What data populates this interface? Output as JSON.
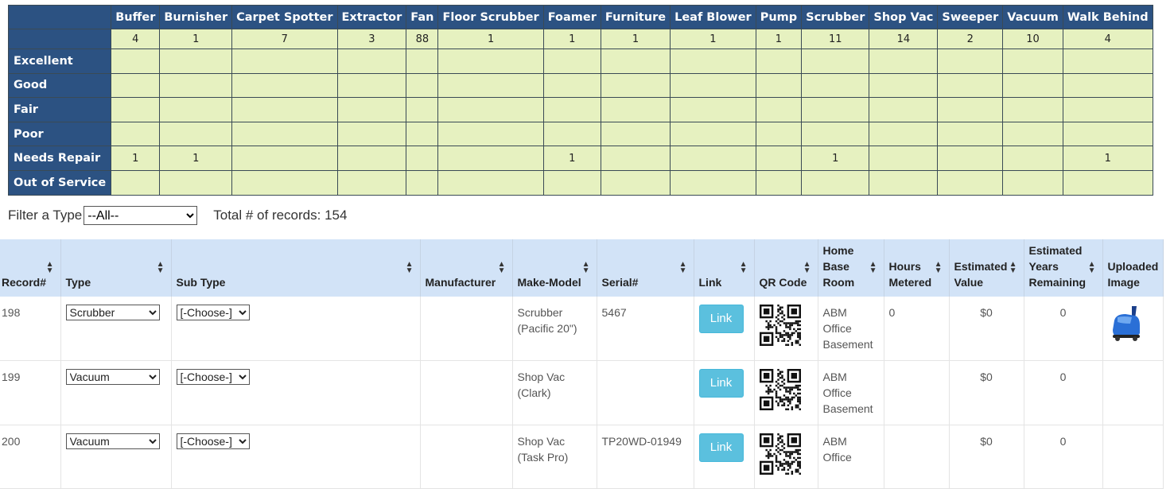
{
  "summary": {
    "columns": [
      "Buffer",
      "Burnisher",
      "Carpet Spotter",
      "Extractor",
      "Fan",
      "Floor Scrubber",
      "Foamer",
      "Furniture",
      "Leaf Blower",
      "Pump",
      "Scrubber",
      "Shop Vac",
      "Sweeper",
      "Vacuum",
      "Walk Behind"
    ],
    "counts": [
      "4",
      "1",
      "7",
      "3",
      "88",
      "1",
      "1",
      "1",
      "1",
      "1",
      "11",
      "14",
      "2",
      "10",
      "4"
    ],
    "rows": [
      {
        "label": "Excellent",
        "values": [
          "",
          "",
          "",
          "",
          "",
          "",
          "",
          "",
          "",
          "",
          "",
          "",
          "",
          "",
          ""
        ]
      },
      {
        "label": "Good",
        "values": [
          "",
          "",
          "",
          "",
          "",
          "",
          "",
          "",
          "",
          "",
          "",
          "",
          "",
          "",
          ""
        ]
      },
      {
        "label": "Fair",
        "values": [
          "",
          "",
          "",
          "",
          "",
          "",
          "",
          "",
          "",
          "",
          "",
          "",
          "",
          "",
          ""
        ]
      },
      {
        "label": "Poor",
        "values": [
          "",
          "",
          "",
          "",
          "",
          "",
          "",
          "",
          "",
          "",
          "",
          "",
          "",
          "",
          ""
        ]
      },
      {
        "label": "Needs Repair",
        "values": [
          "1",
          "1",
          "",
          "",
          "",
          "",
          "1",
          "",
          "",
          "",
          "1",
          "",
          "",
          "",
          "1"
        ]
      },
      {
        "label": "Out of Service",
        "values": [
          "",
          "",
          "",
          "",
          "",
          "",
          "",
          "",
          "",
          "",
          "",
          "",
          "",
          "",
          ""
        ]
      }
    ]
  },
  "filter": {
    "label": "Filter a Type",
    "selected": "--All--",
    "total_text": "Total # of records: 154"
  },
  "records": {
    "headers": [
      "Record#",
      "Type",
      "Sub Type",
      "Manufacturer",
      "Make-Model",
      "Serial#",
      "Link",
      "QR Code",
      "Home Base Room",
      "Hours Metered",
      "Estimated Value",
      "Estimated Years Remaining",
      "Uploaded Image"
    ],
    "rows": [
      {
        "record": "198",
        "type": "Scrubber",
        "subtype": "[-Choose-]",
        "manufacturer": "",
        "model": "Scrubber (Pacific 20\")",
        "serial": "5467",
        "link": "Link",
        "room": "ABM Office Basement",
        "hours": "0",
        "value": "$0",
        "years": "0",
        "has_image": true
      },
      {
        "record": "199",
        "type": "Vacuum",
        "subtype": "[-Choose-]",
        "manufacturer": "",
        "model": "Shop Vac (Clark)",
        "serial": "",
        "link": "Link",
        "room": "ABM Office Basement",
        "hours": "",
        "value": "$0",
        "years": "0",
        "has_image": false
      },
      {
        "record": "200",
        "type": "Vacuum",
        "subtype": "[-Choose-]",
        "manufacturer": "",
        "model": "Shop Vac (Task Pro)",
        "serial": "TP20WD-01949",
        "link": "Link",
        "room": "ABM Office",
        "hours": "",
        "value": "$0",
        "years": "0",
        "has_image": false
      }
    ]
  },
  "icons": {
    "sort": "sort-arrows-icon",
    "qr": "qr-code-icon",
    "image": "scrubber-machine-image"
  },
  "colors": {
    "header_blue": "#2c5282",
    "cell_green": "#e6f1c0",
    "records_header": "#d2e3f7",
    "link_button": "#5bc0de"
  }
}
